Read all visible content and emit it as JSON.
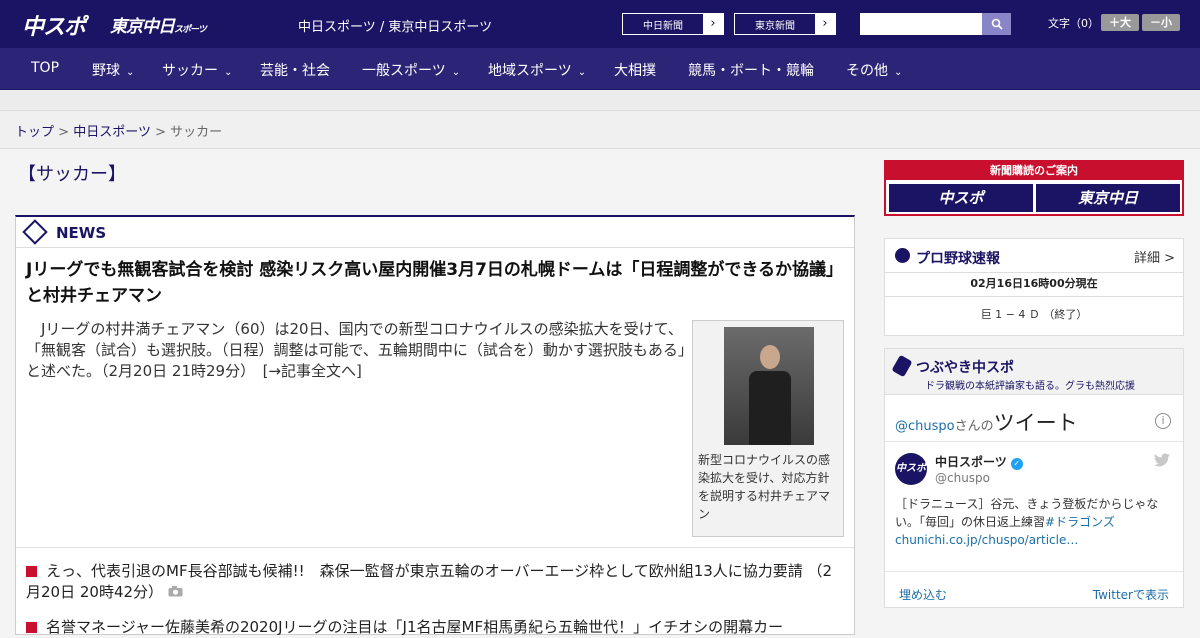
{
  "header": {
    "logo_main": "中スポ",
    "logo_tokyo": "東京中日",
    "logo_tokyo_small": "スポーツ",
    "tagline": "中日スポーツ / 東京中日スポーツ",
    "btn_chunichi": "中日新聞",
    "btn_tokyo": "東京新聞",
    "arrow": "›",
    "search_placeholder": "",
    "font_label": "文字（0）",
    "font_bigger": "＋大",
    "font_smaller": "－小"
  },
  "nav": {
    "items": [
      "TOP",
      "野球",
      "サッカー",
      "芸能・社会",
      "一般スポーツ",
      "地域スポーツ",
      "大相撲",
      "競馬・ボート・競輪",
      "その他"
    ],
    "chevron": "⌄"
  },
  "breadcrumb": {
    "home": "トップ",
    "section": "中日スポーツ",
    "current": "サッカー",
    "sep": ">"
  },
  "category_title": "【サッカー】",
  "news": {
    "label": "NEWS",
    "headline": "Jリーグでも無観客試合を検討 感染リスク高い屋内開催3月7日の札幌ドームは「日程調整ができるか協議」と村井チェアマン",
    "lead": "Jリーグの村井満チェアマン（60）は20日、国内での新型コロナウイルスの感染拡大を受けて、「無観客（試合）も選択肢。（日程）調整は可能で、五輪期間中に（試合を）動かす選択肢もある」と述べた。（2月20日 21時29分）　[→記事全文へ]",
    "photo_caption": "新型コロナウイルスの感染拡大を受け、対応方針を説明する村井チェアマン",
    "list": [
      "えっ、代表引退のMF長谷部誠も候補!!　森保一監督が東京五輪のオーバーエージ枠として欧州組13人に協力要請 （2月20日 20時42分）",
      "名誉マネージャー佐藤美希の2020Jリーグの注目は「J1名古屋MF相馬勇紀ら五輪世代！」イチオシの開幕カー"
    ]
  },
  "sidebar": {
    "subscribe_title": "新聞購読のご案内",
    "sub_chuspo": "中スポ",
    "sub_tokyo": "東京中日",
    "pro_title": "プロ野球速報",
    "pro_detail": "詳細 >",
    "pro_time": "02月16日16時00分現在",
    "pro_score": "巨 1 − 4 Ｄ （終了）",
    "tw_title": "つぶやき中スポ",
    "tw_subtitle": "ドラ観戦の本紙評論家も語る。グラも熱烈応援",
    "tw_handle_link": "@chuspo",
    "tw_san": "さんの",
    "tw_tweets": "ツイート",
    "tw_info": "i",
    "tw_avatar": "中スポ",
    "tw_name": "中日スポーツ",
    "tw_check": "✓",
    "tw_handle": "@chuspo",
    "tw_text": "［ドラニュース］谷元、きょう登板だからじゃない。「毎回」の休日返上練習",
    "tw_hashtag": "#ドラゴンズ",
    "tw_link": "chunichi.co.jp/chuspo/article…",
    "tw_embed": "埋め込む",
    "tw_view": "Twitterで表示"
  }
}
